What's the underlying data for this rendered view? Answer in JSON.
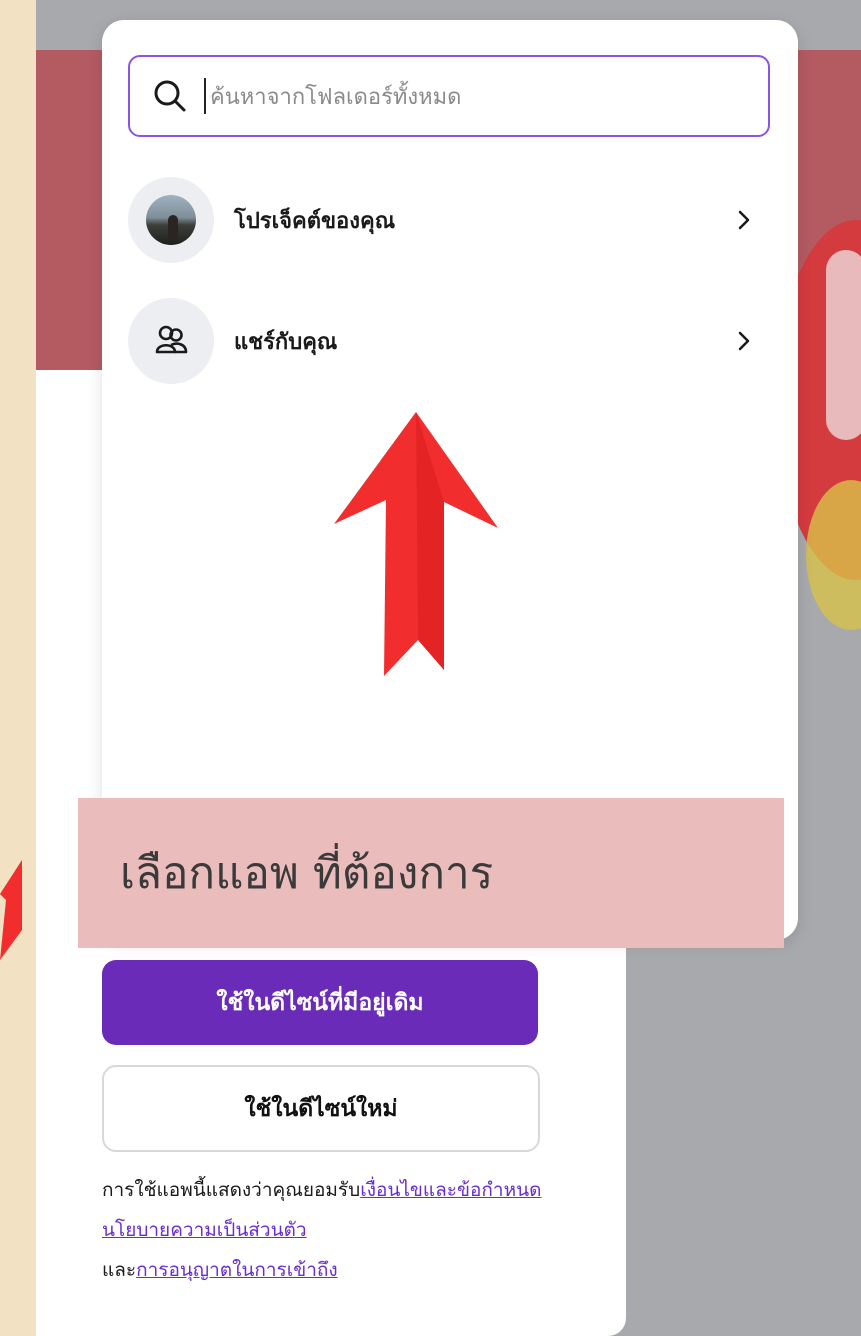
{
  "search": {
    "placeholder": "ค้นหาจากโฟลเดอร์ทั้งหมด"
  },
  "folders": [
    {
      "label": "โปรเจ็คต์ของคุณ",
      "icon": "avatar"
    },
    {
      "label": "แชร์กับคุณ",
      "icon": "people-icon"
    }
  ],
  "annotation": {
    "text": "เลือกแอพ ที่ต้องการ",
    "arrow_color": "#f22d2d",
    "banner_color": "#ebbcbc"
  },
  "buttons": {
    "use_existing": "ใช้ในดีไซน์ที่มีอยู่เดิม",
    "use_new": "ใช้ในดีไซน์ใหม่"
  },
  "terms": {
    "prefix": "การใช้แอพนี้แสดงว่าคุณยอมรับ",
    "link_terms": "เงื่อนไขและข้อกำหนด",
    "link_privacy": "นโยบายความเป็นส่วนตัว",
    "and": "และ",
    "link_access": "การอนุญาตในการเข้าถึง"
  },
  "colors": {
    "accent": "#6a2bb8",
    "search_border": "#8b53e6",
    "link": "#6a2bd6"
  }
}
